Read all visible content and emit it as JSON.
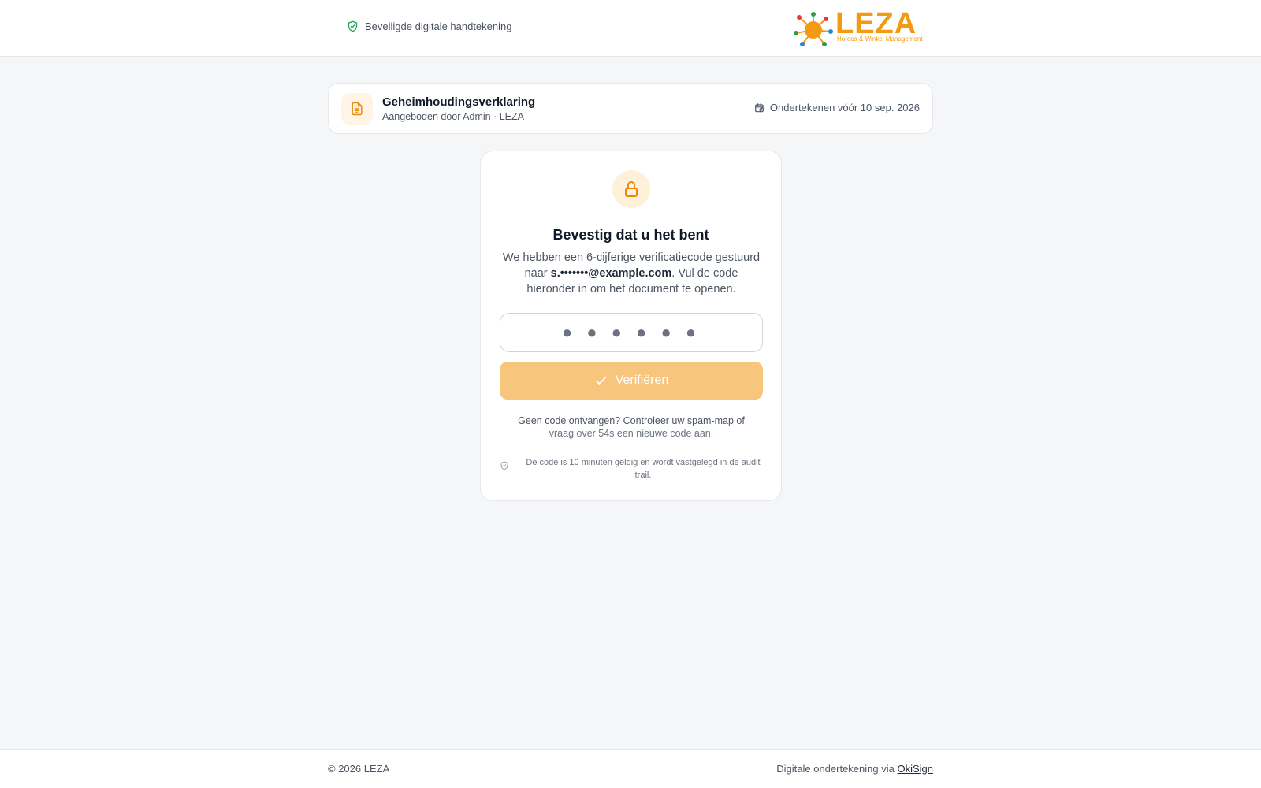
{
  "header": {
    "secure_label": "Beveiligde digitale handtekening",
    "logo_text": "LEZA",
    "logo_tagline": "Horeca & Winkel Management"
  },
  "document": {
    "title": "Geheimhoudingsverklaring",
    "subtitle": "Aangeboden door Admin · LEZA",
    "deadline": "Ondertekenen vóór 10 sep. 2026"
  },
  "verify": {
    "title": "Bevestig dat u het bent",
    "desc_pre": "We hebben een 6-cijferige verificatiecode gestuurd naar ",
    "email": "s.•••••••@example.com",
    "desc_post": ". Vul de code hieronder in om het document te openen.",
    "code_placeholder": "● ● ● ● ● ●",
    "code_value": "",
    "button_label": "Verifiëren",
    "resend_pre": "Geen code ontvangen? Controleer uw spam-map of",
    "resend_muted": "vraag over 54s een nieuwe code aan",
    "resend_post": ".",
    "audit_note": "De code is 10 minuten geldig en wordt vastgelegd in de audit trail."
  },
  "footer": {
    "copyright": "© 2026 LEZA",
    "via_label": "Digitale ondertekening via ",
    "via_link": "OkiSign"
  },
  "colors": {
    "accent": "#f29a12",
    "button_disabled": "#f8c57c",
    "secure_green": "#16a34a"
  }
}
